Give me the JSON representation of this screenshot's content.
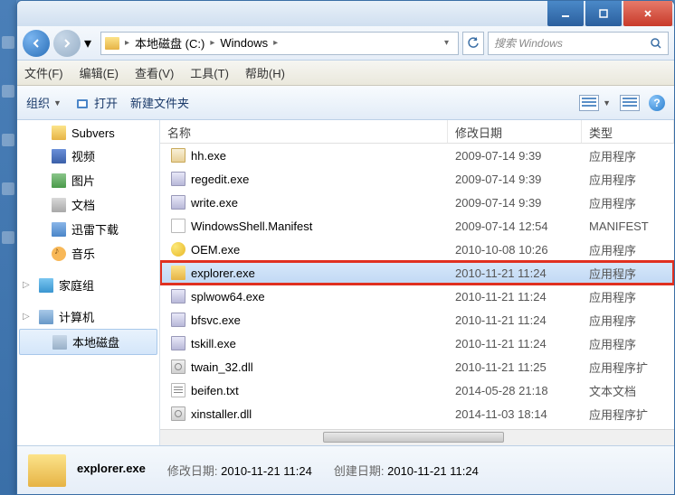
{
  "breadcrumb": {
    "items": [
      "本地磁盘 (C:)",
      "Windows"
    ]
  },
  "search": {
    "placeholder": "搜索 Windows"
  },
  "menubar": {
    "items": [
      "文件(F)",
      "编辑(E)",
      "查看(V)",
      "工具(T)",
      "帮助(H)"
    ]
  },
  "toolbar": {
    "organize": "组织",
    "open": "打开",
    "new_folder": "新建文件夹"
  },
  "sidebar": {
    "items": [
      {
        "label": "Subvers",
        "icon": "folder",
        "indent": 1
      },
      {
        "label": "视频",
        "icon": "video",
        "indent": 1
      },
      {
        "label": "图片",
        "icon": "pic",
        "indent": 1
      },
      {
        "label": "文档",
        "icon": "doc",
        "indent": 1
      },
      {
        "label": "迅雷下载",
        "icon": "dl",
        "indent": 1
      },
      {
        "label": "音乐",
        "icon": "music",
        "indent": 1
      },
      {
        "label": "家庭组",
        "icon": "home",
        "indent": 0,
        "group": true
      },
      {
        "label": "计算机",
        "icon": "pc",
        "indent": 0,
        "group": true
      },
      {
        "label": "本地磁盘",
        "icon": "drive",
        "indent": 1,
        "selected": true
      }
    ]
  },
  "columns": {
    "name": "名称",
    "date": "修改日期",
    "type": "类型"
  },
  "files": [
    {
      "name": "hh.exe",
      "date": "2009-07-14 9:39",
      "type": "应用程序",
      "icon": "exe2"
    },
    {
      "name": "regedit.exe",
      "date": "2009-07-14 9:39",
      "type": "应用程序",
      "icon": "exe"
    },
    {
      "name": "write.exe",
      "date": "2009-07-14 9:39",
      "type": "应用程序",
      "icon": "exe"
    },
    {
      "name": "WindowsShell.Manifest",
      "date": "2009-07-14 12:54",
      "type": "MANIFEST",
      "icon": "file"
    },
    {
      "name": "OEM.exe",
      "date": "2010-10-08 10:26",
      "type": "应用程序",
      "icon": "yellow"
    },
    {
      "name": "explorer.exe",
      "date": "2010-11-21 11:24",
      "type": "应用程序",
      "icon": "folder",
      "selected": true,
      "highlighted": true
    },
    {
      "name": "splwow64.exe",
      "date": "2010-11-21 11:24",
      "type": "应用程序",
      "icon": "exe"
    },
    {
      "name": "bfsvc.exe",
      "date": "2010-11-21 11:24",
      "type": "应用程序",
      "icon": "exe"
    },
    {
      "name": "tskill.exe",
      "date": "2010-11-21 11:24",
      "type": "应用程序",
      "icon": "exe"
    },
    {
      "name": "twain_32.dll",
      "date": "2010-11-21 11:25",
      "type": "应用程序扩",
      "icon": "dll"
    },
    {
      "name": "beifen.txt",
      "date": "2014-05-28 21:18",
      "type": "文本文档",
      "icon": "txt"
    },
    {
      "name": "xinstaller.dll",
      "date": "2014-11-03 18:14",
      "type": "应用程序扩",
      "icon": "dll"
    }
  ],
  "status": {
    "filename": "explorer.exe",
    "mod_label": "修改日期:",
    "mod_value": "2010-11-21 11:24",
    "create_label": "创建日期:",
    "create_value": "2010-11-21 11:24"
  }
}
